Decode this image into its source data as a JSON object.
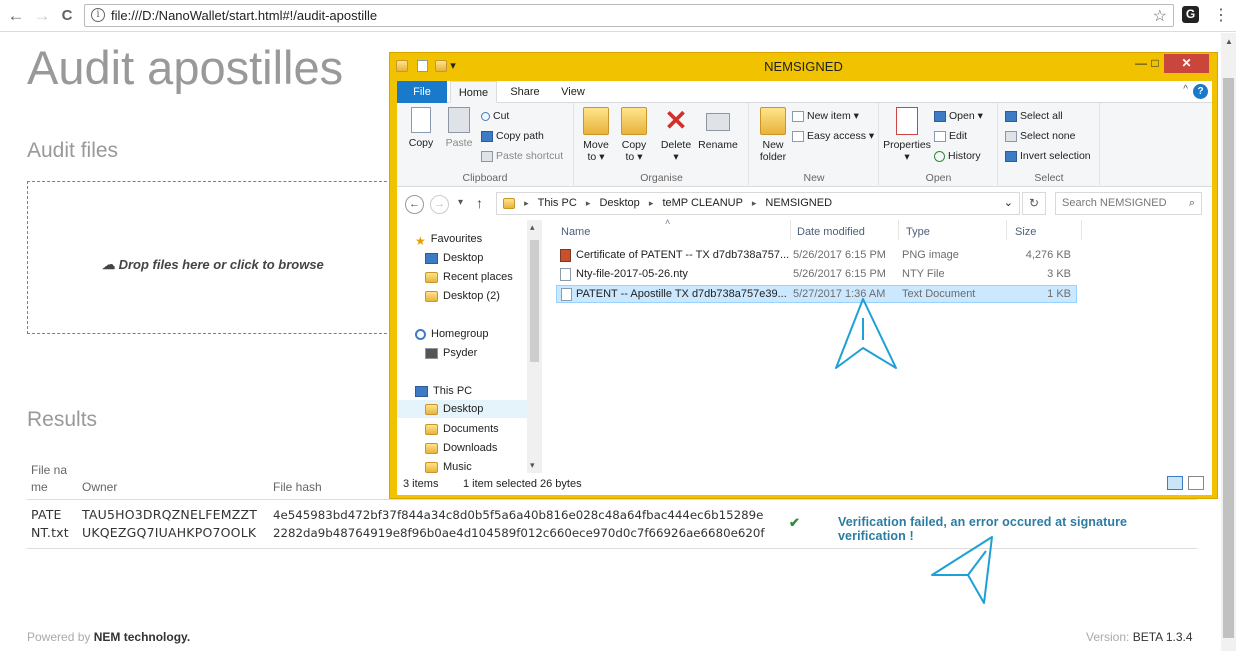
{
  "browser": {
    "url": "file:///D:/NanoWallet/start.html#!/audit-apostille",
    "back_icon": "←",
    "forward_icon": "→",
    "reload_icon": "C",
    "info_icon": "i",
    "star_icon": "☆",
    "extension_label": "G",
    "menu_icon": "⋮"
  },
  "page": {
    "title": "Audit apostilles",
    "audit_files_heading": "Audit files",
    "dropzone_text": "☁ Drop files here or click to browse",
    "results_heading": "Results",
    "table": {
      "headers": [
        "File na\nme",
        "Owner",
        "File hash"
      ],
      "row": {
        "filename_lines": [
          "PATE",
          "NT.txt"
        ],
        "owner_lines": [
          "TAU5HO3DRQZNELFEMZZT",
          "UKQEZGQ7IUAHKPO7OOLK"
        ],
        "hash_lines": [
          "4e545983bd472bf37f844a34c8d0b5f5a6a40b816e028c48a64fbac444ec6b15289e",
          "2282da9b48764919e8f96b0ae4d104589f012c660ece970d0c7f66926ae6680e620f"
        ],
        "check_icon": "✔",
        "status": "Verification failed, an error occured at signature verification !"
      }
    },
    "footer": {
      "powered_by": "Powered by",
      "company": "NEM technology.",
      "version_label": "Version:",
      "version": "BETA 1.3.4"
    }
  },
  "explorer": {
    "title": "NEMSIGNED",
    "quick_access": "▾",
    "window_buttons": {
      "minimize": "—",
      "maximize": "□",
      "close": "✕"
    },
    "tabs": [
      "File",
      "Home",
      "Share",
      "View"
    ],
    "help_icon": "?",
    "collapse_icon": "^",
    "ribbon": {
      "clipboard": {
        "label": "Clipboard",
        "copy": "Copy",
        "paste": "Paste",
        "cut": "Cut",
        "copy_path": "Copy path",
        "paste_shortcut": "Paste shortcut"
      },
      "organise": {
        "label": "Organise",
        "move_to": "Move\nto ▾",
        "copy_to": "Copy\nto ▾",
        "delete": "Delete\n▾",
        "rename": "Rename"
      },
      "new": {
        "label": "New",
        "new_folder": "New\nfolder",
        "new_item": "New item ▾",
        "easy_access": "Easy access ▾"
      },
      "open": {
        "label": "Open",
        "properties": "Properties\n▾",
        "open": "Open ▾",
        "edit": "Edit",
        "history": "History"
      },
      "select": {
        "label": "Select",
        "select_all": "Select all",
        "select_none": "Select none",
        "invert_selection": "Invert selection"
      }
    },
    "address": {
      "back": "←",
      "forward": "→",
      "recent": "▾",
      "up": "↑",
      "path": [
        "This PC",
        "Desktop",
        "teMP CLEANUP",
        "NEMSIGNED"
      ],
      "path_sep": "▸",
      "dropdown": "⌄",
      "refresh": "↻",
      "search_placeholder": "Search NEMSIGNED",
      "search_icon": "⌕"
    },
    "nav": {
      "favourites": "Favourites",
      "desktop": "Desktop",
      "recent_places": "Recent places",
      "desktop2": "Desktop (2)",
      "homegroup": "Homegroup",
      "psyder": "Psyder",
      "this_pc": "This PC",
      "pc_desktop": "Desktop",
      "documents": "Documents",
      "downloads": "Downloads",
      "music": "Music",
      "scroll_up": "▴",
      "scroll_down": "▾"
    },
    "columns": {
      "name": "Name",
      "date": "Date modified",
      "type": "Type",
      "size": "Size",
      "sort_icon": "˄"
    },
    "files": [
      {
        "name": "Certificate of PATENT -- TX d7db738a757...",
        "date": "5/26/2017 6:15 PM",
        "type": "PNG image",
        "size": "4,276 KB"
      },
      {
        "name": "Nty-file-2017-05-26.nty",
        "date": "5/26/2017 6:15 PM",
        "type": "NTY File",
        "size": "3 KB"
      },
      {
        "name": "PATENT -- Apostille TX d7db738a757e39...",
        "date": "5/27/2017 1:36 AM",
        "type": "Text Document",
        "size": "1 KB"
      }
    ],
    "status": {
      "items": "3 items",
      "selected": "1 item selected",
      "bytes": "26 bytes"
    }
  },
  "colors": {
    "accent_teal": "#2ea58f",
    "status_blue": "#2b7ca3",
    "check_green": "#2e8b3e",
    "annotation_cyan": "#1ea0d6",
    "explorer_border": "#f0c200",
    "file_tab": "#1979ca"
  }
}
